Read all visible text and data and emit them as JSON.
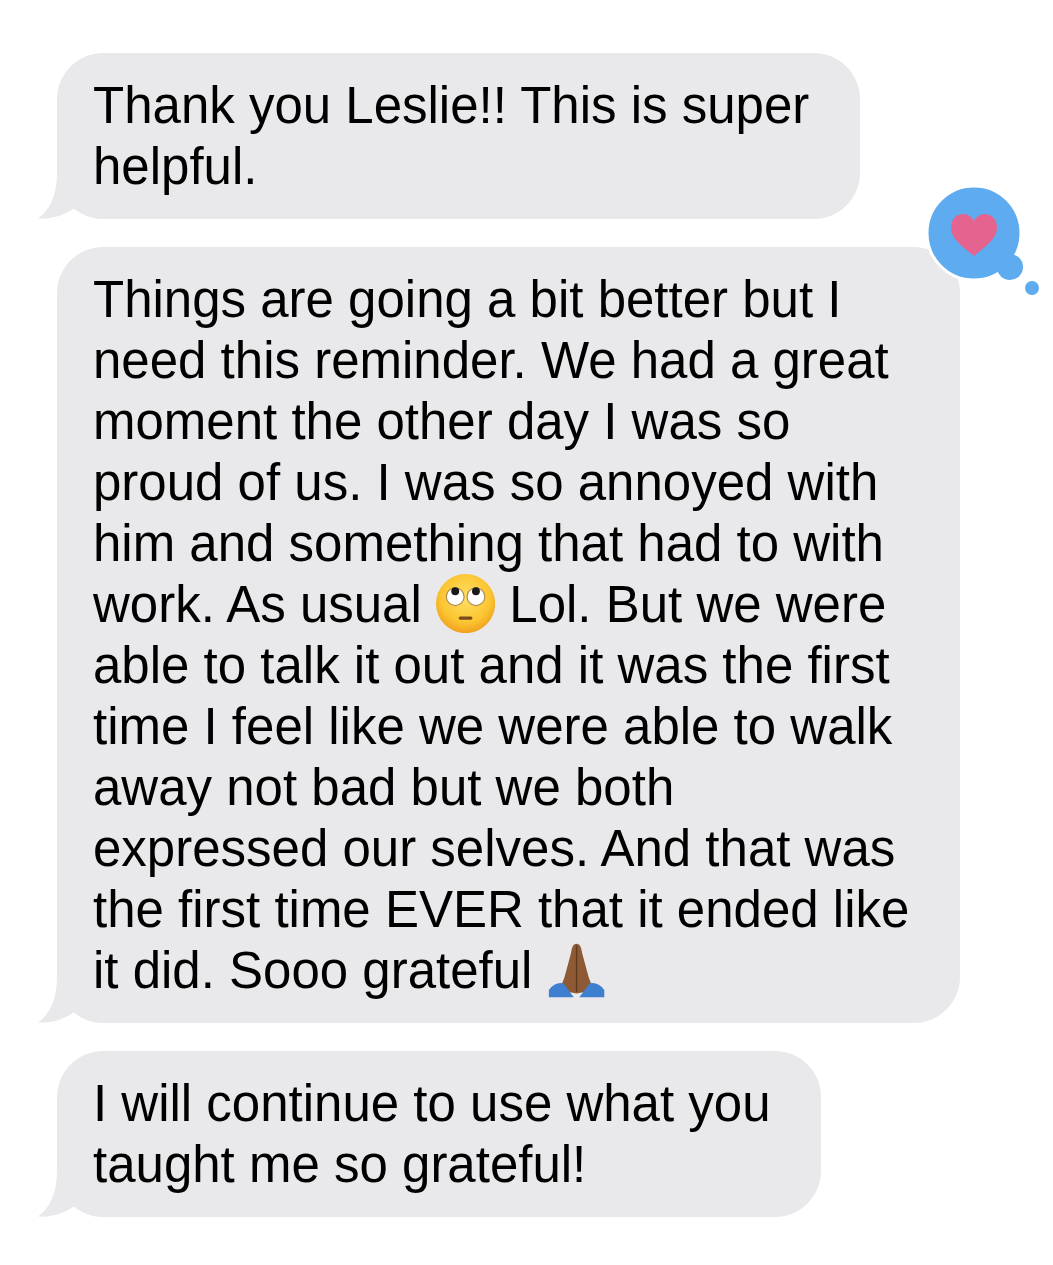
{
  "messages": [
    {
      "segments": [
        {
          "kind": "text",
          "text": "Thank you Leslie!! This is super helpful."
        }
      ],
      "reacted": false
    },
    {
      "segments": [
        {
          "kind": "text",
          "text": "Things are going a bit better but I need this reminder. We had a great moment the other day I was so proud of us. I was so annoyed with him and something that had to with work. As usual"
        },
        {
          "kind": "eyeroll"
        },
        {
          "kind": "text",
          "text": "Lol. But we were able to talk it out and it was the first time I feel like we were able to walk away not bad but we both expressed our selves. And that was the first time EVER that it ended like it did. Sooo grateful"
        },
        {
          "kind": "prayer"
        }
      ],
      "reacted": true
    },
    {
      "segments": [
        {
          "kind": "text",
          "text": "I will continue to use what you taught me so grateful!"
        }
      ],
      "reacted": false
    }
  ]
}
